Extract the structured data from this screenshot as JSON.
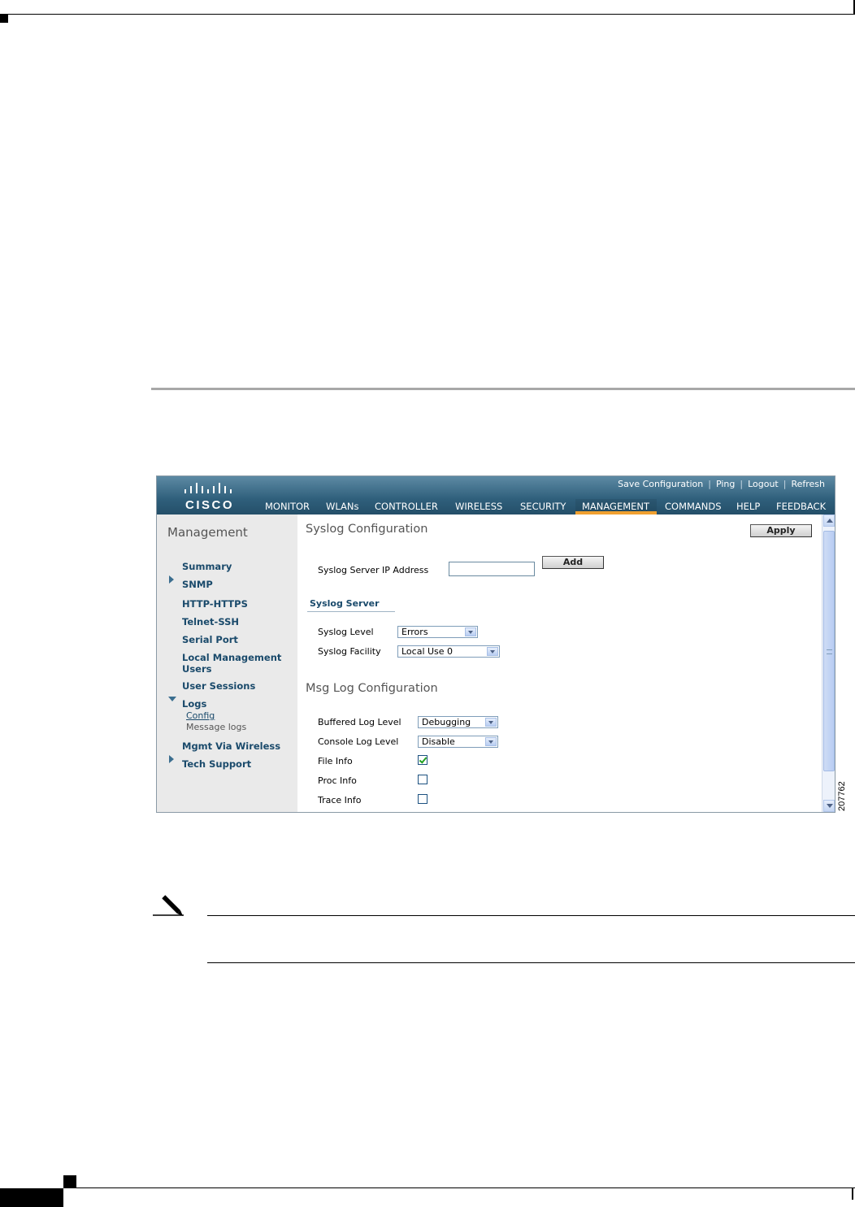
{
  "document": {
    "figure_number": "207762"
  },
  "app": {
    "logo_text": "CISCO",
    "utility_links": [
      "Save Configuration",
      "Ping",
      "Logout",
      "Refresh"
    ],
    "nav": [
      "MONITOR",
      "WLANs",
      "CONTROLLER",
      "WIRELESS",
      "SECURITY",
      "MANAGEMENT",
      "COMMANDS",
      "HELP",
      "FEEDBACK"
    ],
    "active_nav": "MANAGEMENT",
    "accent_color": "#f0a030",
    "header_color": "#2f5f7b"
  },
  "sidebar": {
    "title": "Management",
    "items": [
      "Summary",
      "SNMP",
      "HTTP-HTTPS",
      "Telnet-SSH",
      "Serial Port",
      "Local Management Users",
      "User Sessions",
      "Logs",
      "Mgmt Via Wireless",
      "Tech Support"
    ],
    "logs_children": [
      "Config",
      "Message logs"
    ]
  },
  "syslog": {
    "title": "Syslog Configuration",
    "apply_label": "Apply",
    "server_ip_label": "Syslog Server IP Address",
    "server_ip_value": "",
    "add_label": "Add",
    "server_section": "Syslog Server",
    "level_label": "Syslog Level",
    "level_value": "Errors",
    "facility_label": "Syslog Facility",
    "facility_value": "Local Use 0"
  },
  "msglog": {
    "title": "Msg Log Configuration",
    "buffered_label": "Buffered Log Level",
    "buffered_value": "Debugging",
    "console_label": "Console Log Level",
    "console_value": "Disable",
    "file_info_label": "File Info",
    "file_info_checked": true,
    "proc_info_label": "Proc Info",
    "proc_info_checked": false,
    "trace_info_label": "Trace Info",
    "trace_info_checked": false
  }
}
